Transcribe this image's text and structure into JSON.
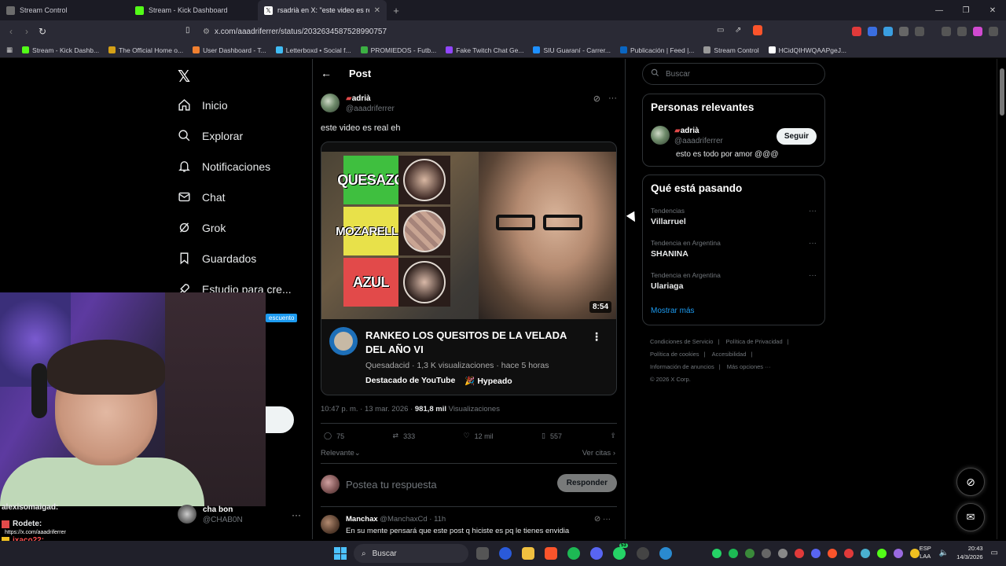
{
  "browser": {
    "tabs": [
      {
        "label": "Stream Control",
        "color": "#6c6c6c"
      },
      {
        "label": "Stream - Kick Dashboard",
        "color": "#53fc18"
      },
      {
        "label": "rsadrià en X: \"este video es real",
        "color": "#ffffff"
      }
    ],
    "url": "x.com/aaadriferrer/status/2032634587528990757",
    "bookmarks": [
      {
        "label": "Stream - Kick Dashb...",
        "color": "#53fc18"
      },
      {
        "label": "The Official Home o...",
        "color": "#d4a017"
      },
      {
        "label": "User Dashboard - T...",
        "color": "#f08030"
      },
      {
        "label": "Letterboxd • Social f...",
        "color": "#40bcf4"
      },
      {
        "label": "PROMIEDOS - Futb...",
        "color": "#3cb043"
      },
      {
        "label": "Fake Twitch Chat Ge...",
        "color": "#9146ff"
      },
      {
        "label": "SIU Guaraní - Carrer...",
        "color": "#1e90ff"
      },
      {
        "label": "Publicación | Feed |...",
        "color": "#0a66c2"
      },
      {
        "label": "Stream Control",
        "color": "#999999"
      },
      {
        "label": "HCidQIHWQAAPgeJ...",
        "color": "#ffffff"
      }
    ]
  },
  "nav": {
    "items": [
      "Inicio",
      "Explorar",
      "Notificaciones",
      "Chat",
      "Grok",
      "Guardados",
      "Estudio para cre..."
    ]
  },
  "post": {
    "header": "Post",
    "display_name": "adrià",
    "handle": "@aaadriferrer",
    "text": "este video es real eh",
    "time": "10:47 p. m. · 13 mar. 2026 · ",
    "views_count": "981,8 mil",
    "views_label": " Visualizaciones",
    "stats": {
      "replies": "75",
      "reposts": "333",
      "likes": "12 mil",
      "bookmarks": "557"
    },
    "relevant": "Relevante",
    "see_quotes": "Ver citas",
    "reply_placeholder": "Postea tu respuesta",
    "reply_button": "Responder"
  },
  "video": {
    "tiers": [
      "QUESAZO",
      "MOZARELLA",
      "AZUL"
    ],
    "tier_colors": [
      "#3fbf3f",
      "#e8e14a",
      "#e24a4a"
    ],
    "duration": "8:54",
    "title": "RANKEO LOS QUESITOS DE LA VELADA DEL AÑO VI",
    "meta": "Quesadacid · 1,3 K visualizaciones · hace 5 horas",
    "tag1": "Destacado de YouTube",
    "tag2": "🎉 Hypeado"
  },
  "comment": {
    "name": "Manchax",
    "meta": " @ManchaxCd · 11h",
    "text": "En su mente pensará que este post q hiciste es pq le tienes envidia"
  },
  "sidebar": {
    "search_placeholder": "Buscar",
    "relevant_title": "Personas relevantes",
    "rel_name": "adrià",
    "rel_handle": "@aaadriferrer",
    "rel_bio": "esto es todo por amor @@@",
    "follow": "Seguir",
    "trending_title": "Qué está pasando",
    "trends": [
      {
        "category": "Tendencias",
        "name": "Villarruel"
      },
      {
        "category": "Tendencia en Argentina",
        "name": "SHANINA"
      },
      {
        "category": "Tendencia en Argentina",
        "name": "Ulariaga"
      }
    ],
    "show_more": "Mostrar más",
    "footer": [
      "Condiciones de Servicio",
      "Política de Privacidad",
      "Política de cookies",
      "Accesibilidad",
      "Información de anuncios",
      "Más opciones ···",
      "© 2026 X Corp."
    ]
  },
  "overlay": {
    "badge": "escuento",
    "chat": [
      {
        "user": "alexisomaigad:",
        "msg": "",
        "color": "#e7e9ea"
      },
      {
        "user": "Rodete:",
        "msg": "https://x.com/aaadriferrer",
        "color": "#e7e9ea"
      },
      {
        "user": "jxaco22:",
        "msg": "",
        "color": "#ff5050"
      }
    ],
    "chab_name": "cha bon",
    "chab_handle": "@CHAB0N"
  },
  "taskbar": {
    "search": "Buscar",
    "lang1": "ESP",
    "lang2": "LAA",
    "time": "20:43",
    "date": "14/3/2026",
    "badge": "53"
  }
}
